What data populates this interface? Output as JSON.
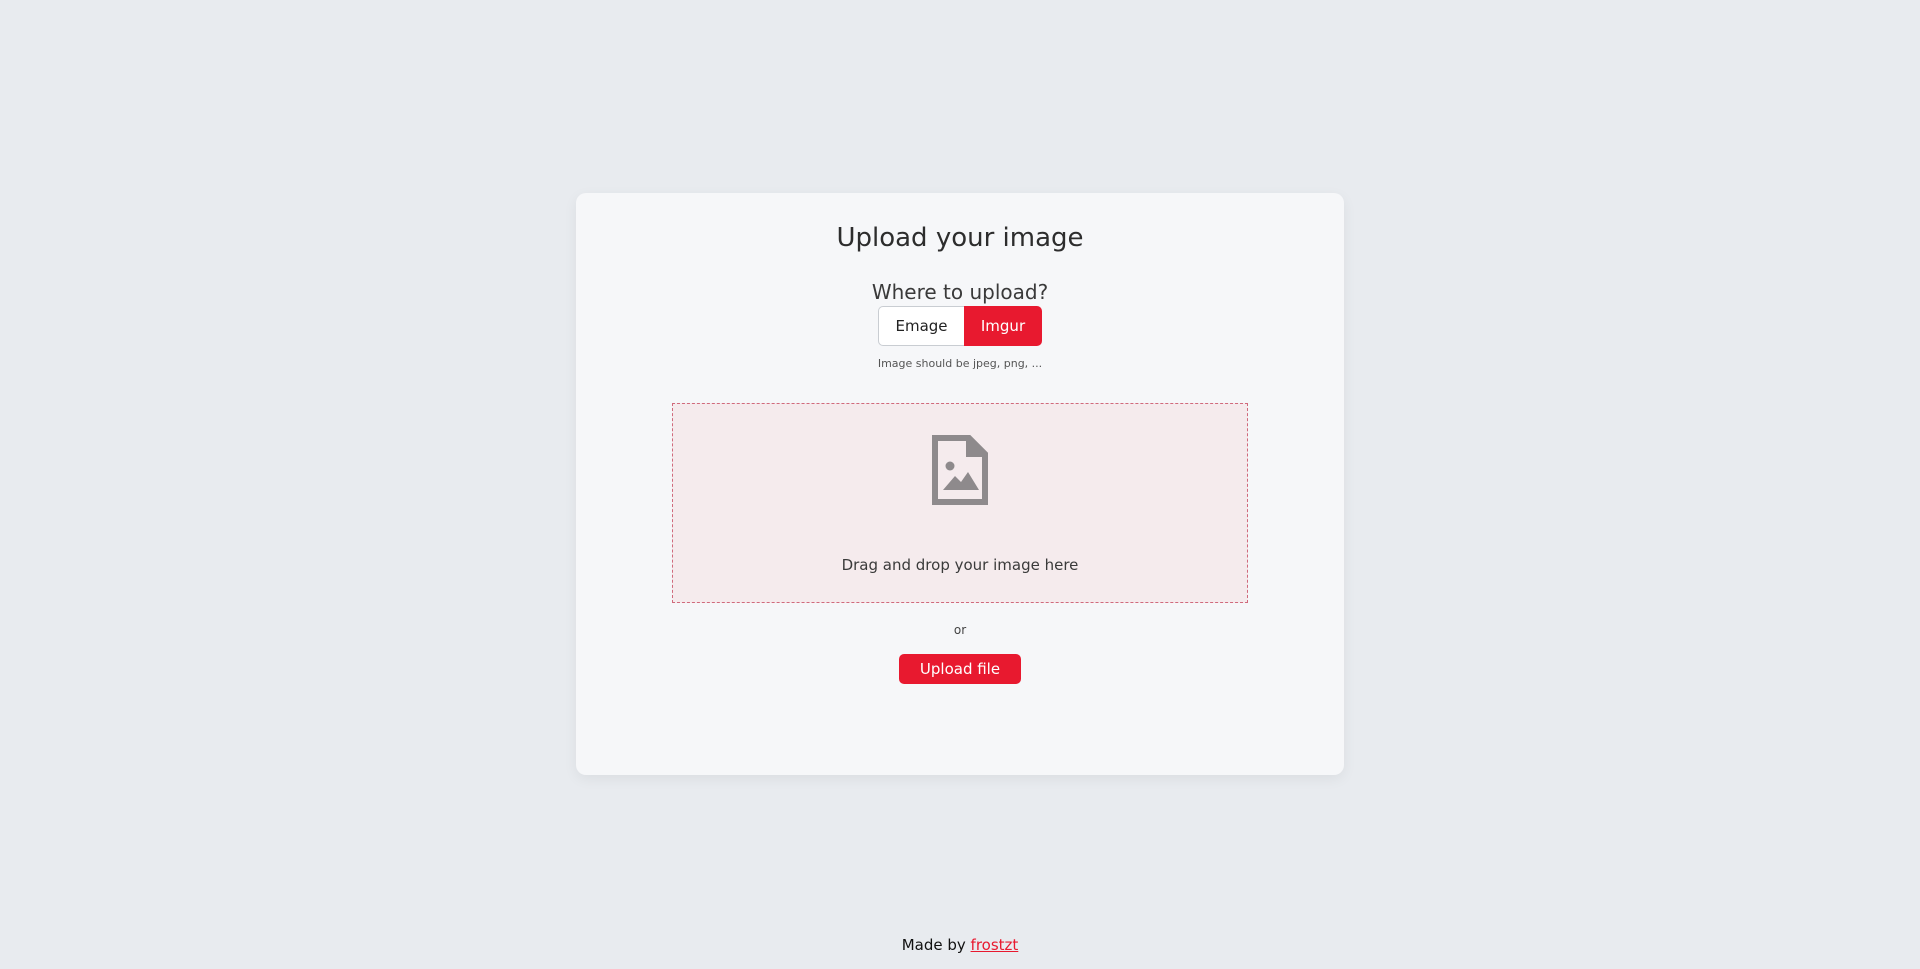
{
  "card": {
    "title": "Upload your image",
    "where_label": "Where to upload?",
    "targets": [
      {
        "label": "Emage",
        "selected": false
      },
      {
        "label": "Imgur",
        "selected": true
      }
    ],
    "hint": "Image should be jpeg, png, ...",
    "dropzone": {
      "icon": "image-file-icon",
      "text": "Drag and drop your image here"
    },
    "or_text": "or",
    "upload_button_label": "Upload file"
  },
  "footer": {
    "prefix": "Made by",
    "author_link": "frostzt"
  },
  "colors": {
    "accent": "#e8192f",
    "background": "#e8ebef",
    "card": "#f6f7f9",
    "dropzone_bg": "#f5ebed",
    "icon": "#8e8a8c"
  }
}
